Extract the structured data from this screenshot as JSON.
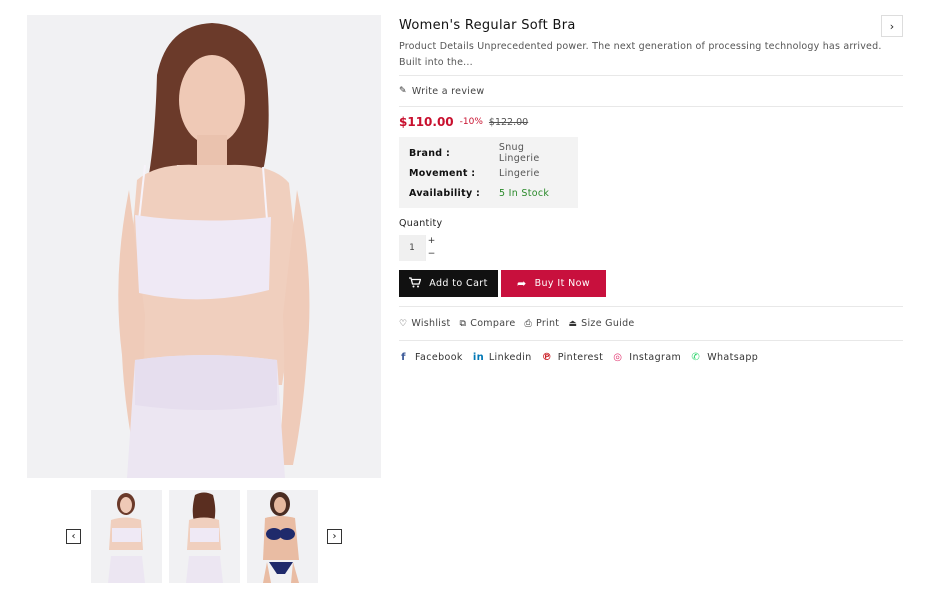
{
  "product": {
    "title": "Women's Regular Soft Bra",
    "description": "Product Details Unprecedented power. The next generation of processing technology has arrived. Built into the...",
    "write_review": "Write a review",
    "price": "$110.00",
    "discount": "-10%",
    "old_price": "$122.00"
  },
  "specs": [
    {
      "label": "Brand :",
      "value": "Snug Lingerie"
    },
    {
      "label": "Movement :",
      "value": "Lingerie"
    },
    {
      "label": "Availability :",
      "value": "5 In Stock"
    }
  ],
  "quantity": {
    "label": "Quantity",
    "value": "1",
    "plus": "+",
    "minus": "−"
  },
  "buttons": {
    "add_to_cart": "Add to Cart",
    "buy_now": "Buy It Now"
  },
  "actions": [
    {
      "label": "Wishlist",
      "icon": "heart-icon"
    },
    {
      "label": "Compare",
      "icon": "compare-icon"
    },
    {
      "label": "Print",
      "icon": "print-icon"
    },
    {
      "label": "Size Guide",
      "icon": "size-guide-icon"
    }
  ],
  "social": [
    {
      "label": "Facebook",
      "icon": "facebook-icon",
      "color": "#3b5998"
    },
    {
      "label": "Linkedin",
      "icon": "linkedin-icon",
      "color": "#0077b5"
    },
    {
      "label": "Pinterest",
      "icon": "pinterest-icon",
      "color": "#cb2027"
    },
    {
      "label": "Instagram",
      "icon": "instagram-icon",
      "color": "#e1306c"
    },
    {
      "label": "Whatsapp",
      "icon": "whatsapp-icon",
      "color": "#25d366"
    }
  ],
  "thumb_nav": {
    "prev": "‹",
    "next": "›"
  },
  "icons": {
    "next_product": "›",
    "pen": "✎",
    "cart": "🛒",
    "buy": "➦",
    "heart": "♡",
    "compare": "⧉",
    "print": "⎙",
    "size_guide": "⏏",
    "facebook": "f",
    "linkedin": "in",
    "pinterest": "℗",
    "instagram": "◎",
    "whatsapp": "✆"
  },
  "colors": {
    "accent": "#c8103d",
    "price": "#c8102e",
    "stock": "#2a8a2a",
    "cart_button": "#111111"
  }
}
